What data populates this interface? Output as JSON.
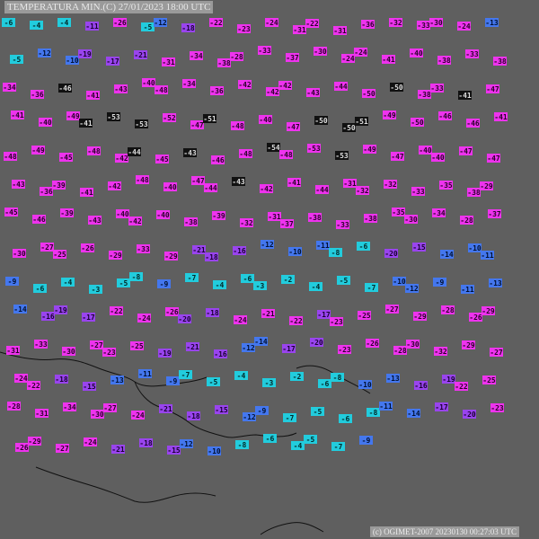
{
  "title": "TEMPERATURA MIN.(C)  27/01/2023 18:00 UTC",
  "credit": "(c) OGIMET-2007 20230130 00:27:03 UTC",
  "colors": {
    "background": "#5f5f5f",
    "magenta": "#ee33ee",
    "violet": "#9944ee",
    "blue": "#4477ee",
    "cyan": "#22ccdd",
    "dark": "#111111",
    "label_bg": "#9a9a9a"
  },
  "stations": [
    {
      "t": "-6",
      "c": "cyan"
    },
    {
      "t": "-4",
      "c": "cyan"
    },
    {
      "t": "-4",
      "c": "cyan"
    },
    {
      "t": "-11",
      "c": "violet"
    },
    {
      "t": "-26",
      "c": "magenta"
    },
    {
      "t": "-5",
      "c": "cyan"
    },
    {
      "t": "-12",
      "c": "blue"
    },
    {
      "t": "-18",
      "c": "violet"
    },
    {
      "t": "-22",
      "c": "magenta"
    },
    {
      "t": "-23",
      "c": "magenta"
    },
    {
      "t": "-24",
      "c": "magenta"
    },
    {
      "t": "-31",
      "c": "magenta"
    },
    {
      "t": "-22",
      "c": "magenta"
    },
    {
      "t": "-31",
      "c": "magenta"
    },
    {
      "t": "-36",
      "c": "magenta"
    },
    {
      "t": "-32",
      "c": "magenta"
    },
    {
      "t": "-33",
      "c": "magenta"
    },
    {
      "t": "-30",
      "c": "magenta"
    },
    {
      "t": "-24",
      "c": "magenta"
    },
    {
      "t": "-13",
      "c": "blue"
    },
    {
      "t": "-5",
      "c": "cyan"
    },
    {
      "t": "-12",
      "c": "blue"
    },
    {
      "t": "-10",
      "c": "blue"
    },
    {
      "t": "-19",
      "c": "violet"
    },
    {
      "t": "-17",
      "c": "violet"
    },
    {
      "t": "-21",
      "c": "violet"
    },
    {
      "t": "-31",
      "c": "magenta"
    },
    {
      "t": "-34",
      "c": "magenta"
    },
    {
      "t": "-38",
      "c": "magenta"
    },
    {
      "t": "-28",
      "c": "magenta"
    },
    {
      "t": "-33",
      "c": "magenta"
    },
    {
      "t": "-37",
      "c": "magenta"
    },
    {
      "t": "-30",
      "c": "magenta"
    },
    {
      "t": "-24",
      "c": "magenta"
    },
    {
      "t": "-24",
      "c": "magenta"
    },
    {
      "t": "-41",
      "c": "magenta"
    },
    {
      "t": "-40",
      "c": "magenta"
    },
    {
      "t": "-38",
      "c": "magenta"
    },
    {
      "t": "-33",
      "c": "magenta"
    },
    {
      "t": "-38",
      "c": "magenta"
    },
    {
      "t": "-34",
      "c": "magenta"
    },
    {
      "t": "-36",
      "c": "magenta"
    },
    {
      "t": "-46",
      "c": "dark"
    },
    {
      "t": "-41",
      "c": "magenta"
    },
    {
      "t": "-43",
      "c": "magenta"
    },
    {
      "t": "-40",
      "c": "magenta"
    },
    {
      "t": "-48",
      "c": "magenta"
    },
    {
      "t": "-34",
      "c": "magenta"
    },
    {
      "t": "-36",
      "c": "magenta"
    },
    {
      "t": "-42",
      "c": "magenta"
    },
    {
      "t": "-42",
      "c": "magenta"
    },
    {
      "t": "-42",
      "c": "magenta"
    },
    {
      "t": "-43",
      "c": "magenta"
    },
    {
      "t": "-44",
      "c": "magenta"
    },
    {
      "t": "-50",
      "c": "magenta"
    },
    {
      "t": "-50",
      "c": "dark"
    },
    {
      "t": "-38",
      "c": "magenta"
    },
    {
      "t": "-33",
      "c": "magenta"
    },
    {
      "t": "-41",
      "c": "dark"
    },
    {
      "t": "-47",
      "c": "magenta"
    },
    {
      "t": "-41",
      "c": "magenta"
    },
    {
      "t": "-40",
      "c": "magenta"
    },
    {
      "t": "-49",
      "c": "magenta"
    },
    {
      "t": "-41",
      "c": "dark"
    },
    {
      "t": "-53",
      "c": "dark"
    },
    {
      "t": "-53",
      "c": "dark"
    },
    {
      "t": "-52",
      "c": "magenta"
    },
    {
      "t": "-47",
      "c": "magenta"
    },
    {
      "t": "-51",
      "c": "dark"
    },
    {
      "t": "-48",
      "c": "magenta"
    },
    {
      "t": "-40",
      "c": "magenta"
    },
    {
      "t": "-47",
      "c": "magenta"
    },
    {
      "t": "-50",
      "c": "dark"
    },
    {
      "t": "-50",
      "c": "dark"
    },
    {
      "t": "-51",
      "c": "dark"
    },
    {
      "t": "-49",
      "c": "magenta"
    },
    {
      "t": "-50",
      "c": "magenta"
    },
    {
      "t": "-46",
      "c": "magenta"
    },
    {
      "t": "-46",
      "c": "magenta"
    },
    {
      "t": "-41",
      "c": "magenta"
    },
    {
      "t": "-48",
      "c": "magenta"
    },
    {
      "t": "-49",
      "c": "magenta"
    },
    {
      "t": "-45",
      "c": "magenta"
    },
    {
      "t": "-48",
      "c": "magenta"
    },
    {
      "t": "-42",
      "c": "magenta"
    },
    {
      "t": "-44",
      "c": "dark"
    },
    {
      "t": "-45",
      "c": "magenta"
    },
    {
      "t": "-43",
      "c": "dark"
    },
    {
      "t": "-46",
      "c": "magenta"
    },
    {
      "t": "-48",
      "c": "magenta"
    },
    {
      "t": "-54",
      "c": "dark"
    },
    {
      "t": "-48",
      "c": "magenta"
    },
    {
      "t": "-53",
      "c": "magenta"
    },
    {
      "t": "-53",
      "c": "dark"
    },
    {
      "t": "-49",
      "c": "magenta"
    },
    {
      "t": "-47",
      "c": "magenta"
    },
    {
      "t": "-40",
      "c": "magenta"
    },
    {
      "t": "-40",
      "c": "magenta"
    },
    {
      "t": "-47",
      "c": "magenta"
    },
    {
      "t": "-47",
      "c": "magenta"
    },
    {
      "t": "-43",
      "c": "magenta"
    },
    {
      "t": "-36",
      "c": "magenta"
    },
    {
      "t": "-39",
      "c": "magenta"
    },
    {
      "t": "-41",
      "c": "magenta"
    },
    {
      "t": "-42",
      "c": "magenta"
    },
    {
      "t": "-48",
      "c": "magenta"
    },
    {
      "t": "-40",
      "c": "magenta"
    },
    {
      "t": "-47",
      "c": "magenta"
    },
    {
      "t": "-44",
      "c": "magenta"
    },
    {
      "t": "-43",
      "c": "dark"
    },
    {
      "t": "-42",
      "c": "magenta"
    },
    {
      "t": "-41",
      "c": "magenta"
    },
    {
      "t": "-44",
      "c": "magenta"
    },
    {
      "t": "-31",
      "c": "magenta"
    },
    {
      "t": "-32",
      "c": "magenta"
    },
    {
      "t": "-32",
      "c": "magenta"
    },
    {
      "t": "-33",
      "c": "magenta"
    },
    {
      "t": "-35",
      "c": "magenta"
    },
    {
      "t": "-38",
      "c": "magenta"
    },
    {
      "t": "-29",
      "c": "magenta"
    },
    {
      "t": "-45",
      "c": "magenta"
    },
    {
      "t": "-46",
      "c": "magenta"
    },
    {
      "t": "-39",
      "c": "magenta"
    },
    {
      "t": "-43",
      "c": "magenta"
    },
    {
      "t": "-40",
      "c": "magenta"
    },
    {
      "t": "-42",
      "c": "magenta"
    },
    {
      "t": "-40",
      "c": "magenta"
    },
    {
      "t": "-38",
      "c": "magenta"
    },
    {
      "t": "-39",
      "c": "magenta"
    },
    {
      "t": "-32",
      "c": "magenta"
    },
    {
      "t": "-31",
      "c": "magenta"
    },
    {
      "t": "-37",
      "c": "magenta"
    },
    {
      "t": "-38",
      "c": "magenta"
    },
    {
      "t": "-33",
      "c": "magenta"
    },
    {
      "t": "-38",
      "c": "magenta"
    },
    {
      "t": "-35",
      "c": "magenta"
    },
    {
      "t": "-30",
      "c": "magenta"
    },
    {
      "t": "-34",
      "c": "magenta"
    },
    {
      "t": "-28",
      "c": "magenta"
    },
    {
      "t": "-37",
      "c": "magenta"
    },
    {
      "t": "-30",
      "c": "magenta"
    },
    {
      "t": "-27",
      "c": "magenta"
    },
    {
      "t": "-25",
      "c": "magenta"
    },
    {
      "t": "-26",
      "c": "magenta"
    },
    {
      "t": "-29",
      "c": "magenta"
    },
    {
      "t": "-33",
      "c": "magenta"
    },
    {
      "t": "-29",
      "c": "magenta"
    },
    {
      "t": "-21",
      "c": "violet"
    },
    {
      "t": "-18",
      "c": "violet"
    },
    {
      "t": "-16",
      "c": "violet"
    },
    {
      "t": "-12",
      "c": "blue"
    },
    {
      "t": "-10",
      "c": "blue"
    },
    {
      "t": "-11",
      "c": "blue"
    },
    {
      "t": "-8",
      "c": "cyan"
    },
    {
      "t": "-6",
      "c": "cyan"
    },
    {
      "t": "-20",
      "c": "violet"
    },
    {
      "t": "-15",
      "c": "violet"
    },
    {
      "t": "-14",
      "c": "blue"
    },
    {
      "t": "-10",
      "c": "blue"
    },
    {
      "t": "-11",
      "c": "blue"
    },
    {
      "t": "-9",
      "c": "blue"
    },
    {
      "t": "-6",
      "c": "cyan"
    },
    {
      "t": "-4",
      "c": "cyan"
    },
    {
      "t": "-3",
      "c": "cyan"
    },
    {
      "t": "-5",
      "c": "cyan"
    },
    {
      "t": "-8",
      "c": "cyan"
    },
    {
      "t": "-9",
      "c": "blue"
    },
    {
      "t": "-7",
      "c": "cyan"
    },
    {
      "t": "-4",
      "c": "cyan"
    },
    {
      "t": "-6",
      "c": "cyan"
    },
    {
      "t": "-3",
      "c": "cyan"
    },
    {
      "t": "-2",
      "c": "cyan"
    },
    {
      "t": "-4",
      "c": "cyan"
    },
    {
      "t": "-5",
      "c": "cyan"
    },
    {
      "t": "-7",
      "c": "cyan"
    },
    {
      "t": "-10",
      "c": "blue"
    },
    {
      "t": "-12",
      "c": "blue"
    },
    {
      "t": "-9",
      "c": "blue"
    },
    {
      "t": "-11",
      "c": "blue"
    },
    {
      "t": "-13",
      "c": "blue"
    },
    {
      "t": "-14",
      "c": "blue"
    },
    {
      "t": "-16",
      "c": "violet"
    },
    {
      "t": "-19",
      "c": "violet"
    },
    {
      "t": "-17",
      "c": "violet"
    },
    {
      "t": "-22",
      "c": "magenta"
    },
    {
      "t": "-24",
      "c": "magenta"
    },
    {
      "t": "-26",
      "c": "magenta"
    },
    {
      "t": "-20",
      "c": "violet"
    },
    {
      "t": "-18",
      "c": "violet"
    },
    {
      "t": "-24",
      "c": "magenta"
    },
    {
      "t": "-21",
      "c": "magenta"
    },
    {
      "t": "-22",
      "c": "magenta"
    },
    {
      "t": "-17",
      "c": "violet"
    },
    {
      "t": "-23",
      "c": "magenta"
    },
    {
      "t": "-25",
      "c": "magenta"
    },
    {
      "t": "-27",
      "c": "magenta"
    },
    {
      "t": "-29",
      "c": "magenta"
    },
    {
      "t": "-28",
      "c": "magenta"
    },
    {
      "t": "-26",
      "c": "magenta"
    },
    {
      "t": "-29",
      "c": "magenta"
    },
    {
      "t": "-31",
      "c": "magenta"
    },
    {
      "t": "-33",
      "c": "magenta"
    },
    {
      "t": "-30",
      "c": "magenta"
    },
    {
      "t": "-27",
      "c": "magenta"
    },
    {
      "t": "-23",
      "c": "magenta"
    },
    {
      "t": "-25",
      "c": "magenta"
    },
    {
      "t": "-19",
      "c": "violet"
    },
    {
      "t": "-21",
      "c": "violet"
    },
    {
      "t": "-16",
      "c": "violet"
    },
    {
      "t": "-12",
      "c": "blue"
    },
    {
      "t": "-14",
      "c": "blue"
    },
    {
      "t": "-17",
      "c": "violet"
    },
    {
      "t": "-20",
      "c": "violet"
    },
    {
      "t": "-23",
      "c": "magenta"
    },
    {
      "t": "-26",
      "c": "magenta"
    },
    {
      "t": "-28",
      "c": "magenta"
    },
    {
      "t": "-30",
      "c": "magenta"
    },
    {
      "t": "-32",
      "c": "magenta"
    },
    {
      "t": "-29",
      "c": "magenta"
    },
    {
      "t": "-27",
      "c": "magenta"
    },
    {
      "t": "-24",
      "c": "magenta"
    },
    {
      "t": "-22",
      "c": "magenta"
    },
    {
      "t": "-18",
      "c": "violet"
    },
    {
      "t": "-15",
      "c": "violet"
    },
    {
      "t": "-13",
      "c": "blue"
    },
    {
      "t": "-11",
      "c": "blue"
    },
    {
      "t": "-9",
      "c": "blue"
    },
    {
      "t": "-7",
      "c": "cyan"
    },
    {
      "t": "-5",
      "c": "cyan"
    },
    {
      "t": "-4",
      "c": "cyan"
    },
    {
      "t": "-3",
      "c": "cyan"
    },
    {
      "t": "-2",
      "c": "cyan"
    },
    {
      "t": "-6",
      "c": "cyan"
    },
    {
      "t": "-8",
      "c": "cyan"
    },
    {
      "t": "-10",
      "c": "blue"
    },
    {
      "t": "-13",
      "c": "blue"
    },
    {
      "t": "-16",
      "c": "violet"
    },
    {
      "t": "-19",
      "c": "violet"
    },
    {
      "t": "-22",
      "c": "magenta"
    },
    {
      "t": "-25",
      "c": "magenta"
    },
    {
      "t": "-28",
      "c": "magenta"
    },
    {
      "t": "-31",
      "c": "magenta"
    },
    {
      "t": "-34",
      "c": "magenta"
    },
    {
      "t": "-30",
      "c": "magenta"
    },
    {
      "t": "-27",
      "c": "magenta"
    },
    {
      "t": "-24",
      "c": "magenta"
    },
    {
      "t": "-21",
      "c": "violet"
    },
    {
      "t": "-18",
      "c": "violet"
    },
    {
      "t": "-15",
      "c": "violet"
    },
    {
      "t": "-12",
      "c": "blue"
    },
    {
      "t": "-9",
      "c": "blue"
    },
    {
      "t": "-7",
      "c": "cyan"
    },
    {
      "t": "-5",
      "c": "cyan"
    },
    {
      "t": "-6",
      "c": "cyan"
    },
    {
      "t": "-8",
      "c": "cyan"
    },
    {
      "t": "-11",
      "c": "blue"
    },
    {
      "t": "-14",
      "c": "blue"
    },
    {
      "t": "-17",
      "c": "violet"
    },
    {
      "t": "-20",
      "c": "violet"
    },
    {
      "t": "-23",
      "c": "magenta"
    },
    {
      "t": "-26",
      "c": "magenta"
    },
    {
      "t": "-29",
      "c": "magenta"
    },
    {
      "t": "-27",
      "c": "magenta"
    },
    {
      "t": "-24",
      "c": "magenta"
    },
    {
      "t": "-21",
      "c": "violet"
    },
    {
      "t": "-18",
      "c": "violet"
    },
    {
      "t": "-15",
      "c": "violet"
    },
    {
      "t": "-12",
      "c": "blue"
    },
    {
      "t": "-10",
      "c": "blue"
    },
    {
      "t": "-8",
      "c": "cyan"
    },
    {
      "t": "-6",
      "c": "cyan"
    },
    {
      "t": "-4",
      "c": "cyan"
    },
    {
      "t": "-5",
      "c": "cyan"
    },
    {
      "t": "-7",
      "c": "cyan"
    },
    {
      "t": "-9",
      "c": "blue"
    }
  ]
}
